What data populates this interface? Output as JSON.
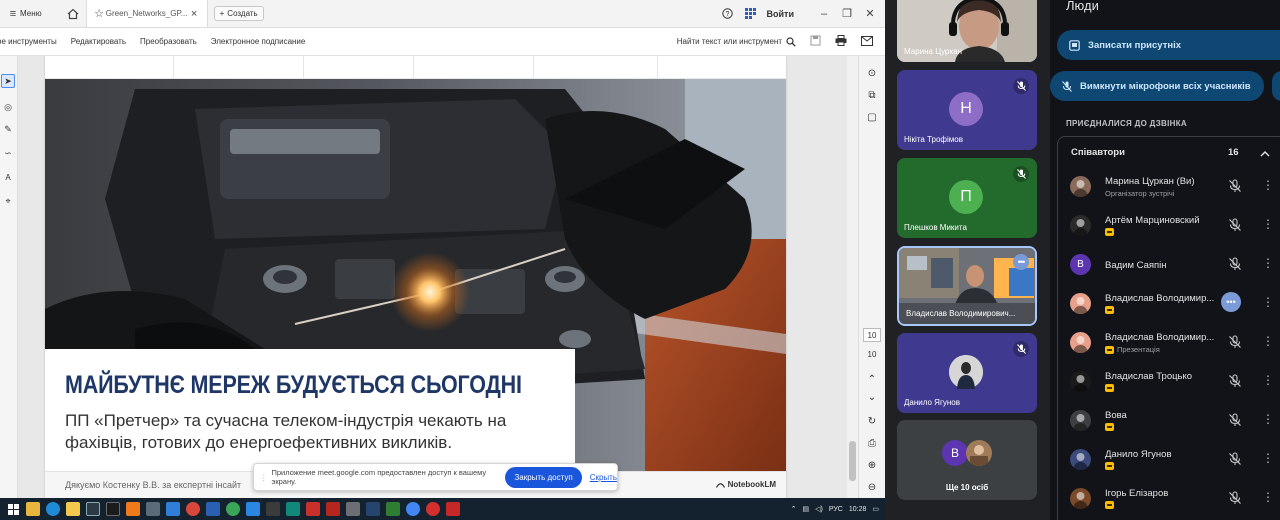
{
  "viewer": {
    "tabs": {
      "home_tab": "Меню",
      "doc_tab": "Green_Networks_GP...",
      "create": "Создать"
    },
    "login": "Войти",
    "menu": [
      "ое инструменты",
      "Редактировать",
      "Преобразовать",
      "Электронное подписание"
    ],
    "search": "Найти текст или инструмент",
    "page_current": "10",
    "page_total": "10"
  },
  "slide": {
    "headline": "МАЙБУТНЄ МЕРЕЖ БУДУЄТЬСЯ СЬОГОДНІ",
    "subline": "ПП «Претчер» та сучасна телеком-індустрія чекають на фахівців, готових до енергоефективних викликів.",
    "footer": "Дякуємо Костенку В.В. за експертні інсайт",
    "brand": "NotebookLM"
  },
  "share_notice": {
    "text": "Приложение meet.google.com предоставлен доступ к вашему экрану.",
    "stop": "Закрыть доступ",
    "hide": "Скрыть"
  },
  "taskbar": {
    "lang": "РУС",
    "time": "10:28"
  },
  "tiles": [
    {
      "name": "Марина Цуркан",
      "kind": "video"
    },
    {
      "name": "Нікіта Трофімов",
      "initial": "Н",
      "color": "#8e6dc7",
      "bg": "#3f3a8f"
    },
    {
      "name": "Плешков Микита",
      "initial": "П",
      "color": "#4caf50",
      "bg": "#236b2c"
    },
    {
      "name": "Владислав Володимирович...",
      "kind": "video"
    },
    {
      "name": "Данило Ягунов",
      "kind": "photo",
      "bg": "#3f3a8f"
    },
    {
      "name": "Ще 10 осіб",
      "initial": "В",
      "bg": "#3c4043"
    }
  ],
  "people": {
    "title": "Люди",
    "record_btn": "Записати присутніх",
    "mute_all_btn": "Вимкнути мікрофони всіх учасників",
    "joined_label": "ПРИЄДНАЛИСЯ ДО ДЗВІНКА",
    "group": "Співавтори",
    "count": "16",
    "list": [
      {
        "name": "Марина Цуркан (Ви)",
        "sub": "Організатор зустрічі",
        "av": "#8a6a58",
        "badge": false
      },
      {
        "name": "Артём Марциновский",
        "sub": "",
        "av": "#2b2b2b",
        "badge": true
      },
      {
        "name": "Вадим Саяпін",
        "sub": "",
        "av": "#5e35b1",
        "initial": "В",
        "badge": false
      },
      {
        "name": "Владислав Володимир...",
        "sub": "",
        "av": "#e8a08a",
        "badge": true,
        "speaking": true
      },
      {
        "name": "Владислав Володимир...",
        "sub": "Презентація",
        "av": "#e8a08a",
        "badge": true
      },
      {
        "name": "Владислав Троцько",
        "sub": "",
        "av": "#1a1a1a",
        "badge": true
      },
      {
        "name": "Вова",
        "sub": "",
        "av": "#3c4043",
        "badge": true
      },
      {
        "name": "Данило Ягунов",
        "sub": "",
        "av": "#3a4a7a",
        "badge": true
      },
      {
        "name": "Ігорь Елізаров",
        "sub": "",
        "av": "#7a4a2a",
        "badge": true
      }
    ]
  }
}
